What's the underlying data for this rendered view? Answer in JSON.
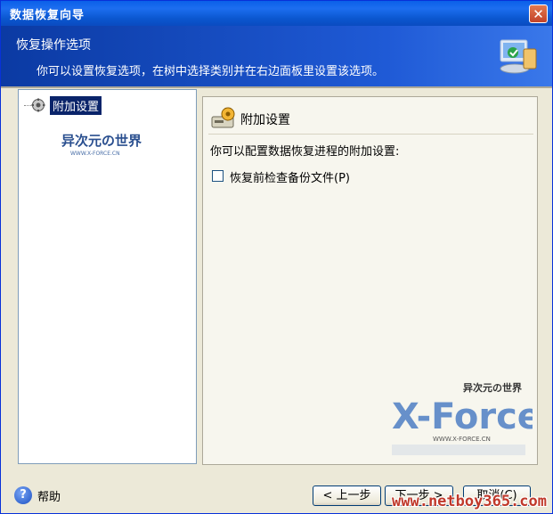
{
  "window": {
    "title": "数据恢复向导",
    "close_symbol": "✕"
  },
  "header": {
    "title": "恢复操作选项",
    "subtitle": "你可以设置恢复选项，在树中选择类别并在右边面板里设置该选项。"
  },
  "tree": {
    "items": [
      {
        "label": "附加设置",
        "icon": "gear-icon",
        "selected": true
      }
    ]
  },
  "watermark_small": {
    "main": "异次元の世界",
    "sub": "WWW.X-FORCE.CN"
  },
  "panel": {
    "title": "附加设置",
    "description": "你可以配置数据恢复进程的附加设置:",
    "options": [
      {
        "label": "恢复前检查备份文件(P)",
        "checked": false
      }
    ]
  },
  "watermark_big": {
    "brand": "X-Force",
    "tagline": "异次元の世界",
    "url": "WWW.X-FORCE.CN"
  },
  "footer": {
    "help_symbol": "?",
    "help_label": "帮助",
    "back_label": "< 上一步",
    "next_label": "下一步 >",
    "cancel_label": "取消(C)"
  },
  "overlay_watermark": "www.netboy365.com",
  "colors": {
    "title_bar": "#0a5fe8",
    "header": "#1f5ad6",
    "selection": "#0a246a",
    "window_face": "#ece9d8"
  }
}
